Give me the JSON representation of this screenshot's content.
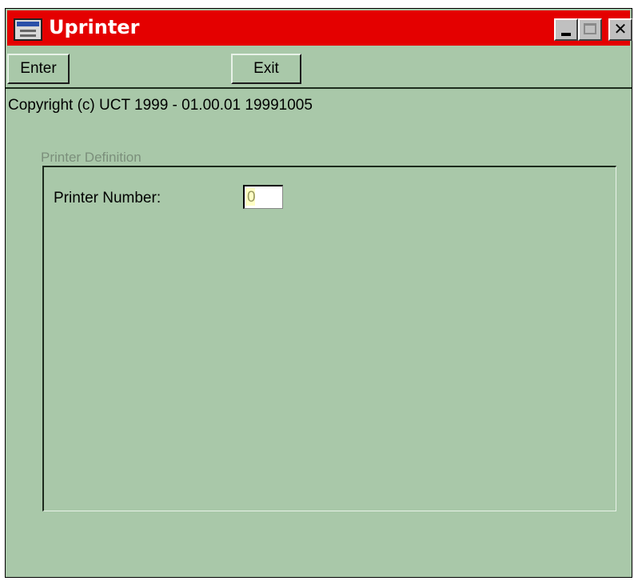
{
  "window": {
    "title": "Uprinter",
    "title_icon": "app-window-icon",
    "controls": {
      "minimize_icon": "minimize-icon",
      "maximize_icon": "maximize-icon",
      "close_label": "✕"
    }
  },
  "toolbar": {
    "enter_label": "Enter",
    "exit_label": "Exit"
  },
  "copyright": "Copyright (c) UCT 1999 - 01.00.01 19991005",
  "printer_definition": {
    "group_title": "Printer Definition",
    "printer_number_label": "Printer Number:",
    "printer_number_value": "0"
  },
  "colors": {
    "titlebar": "#e40000",
    "window_background": "#a9c8a9",
    "group_title_text": "#7b8f7b"
  }
}
